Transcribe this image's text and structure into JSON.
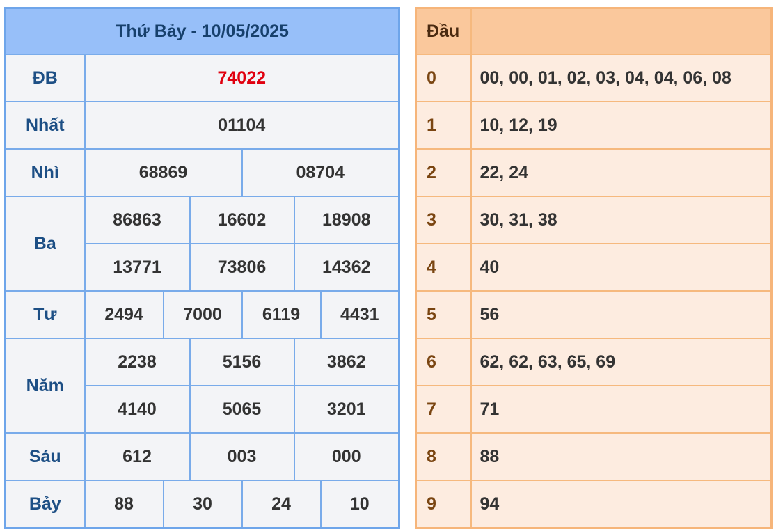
{
  "results": {
    "title": "Thứ Bảy - 10/05/2025",
    "prizes": {
      "db": {
        "label": "ĐB",
        "values": [
          "74022"
        ]
      },
      "nhat": {
        "label": "Nhất",
        "values": [
          "01104"
        ]
      },
      "nhi": {
        "label": "Nhì",
        "values": [
          "68869",
          "08704"
        ]
      },
      "ba": {
        "label": "Ba",
        "values": [
          "86863",
          "16602",
          "18908",
          "13771",
          "73806",
          "14362"
        ]
      },
      "tu": {
        "label": "Tư",
        "values": [
          "2494",
          "7000",
          "6119",
          "4431"
        ]
      },
      "nam": {
        "label": "Năm",
        "values": [
          "2238",
          "5156",
          "3862",
          "4140",
          "5065",
          "3201"
        ]
      },
      "sau": {
        "label": "Sáu",
        "values": [
          "612",
          "003",
          "000"
        ]
      },
      "bay": {
        "label": "Bảy",
        "values": [
          "88",
          "30",
          "24",
          "10"
        ]
      }
    }
  },
  "dau": {
    "header": "Đầu",
    "rows": [
      {
        "digit": "0",
        "values": "00, 00, 01, 02, 03, 04, 04, 06, 08"
      },
      {
        "digit": "1",
        "values": "10, 12, 19"
      },
      {
        "digit": "2",
        "values": "22, 24"
      },
      {
        "digit": "3",
        "values": "30, 31, 38"
      },
      {
        "digit": "4",
        "values": "40"
      },
      {
        "digit": "5",
        "values": "56"
      },
      {
        "digit": "6",
        "values": "62, 62, 63, 65, 69"
      },
      {
        "digit": "7",
        "values": "71"
      },
      {
        "digit": "8",
        "values": "88"
      },
      {
        "digit": "9",
        "values": "94"
      }
    ]
  },
  "colors": {
    "special_prize": "#e0000f",
    "results_header_bg": "#97bff9",
    "results_border": "#79abea",
    "dau_header_bg": "#fac89c",
    "dau_body_bg": "#fdece0",
    "dau_border": "#f6b97e"
  }
}
